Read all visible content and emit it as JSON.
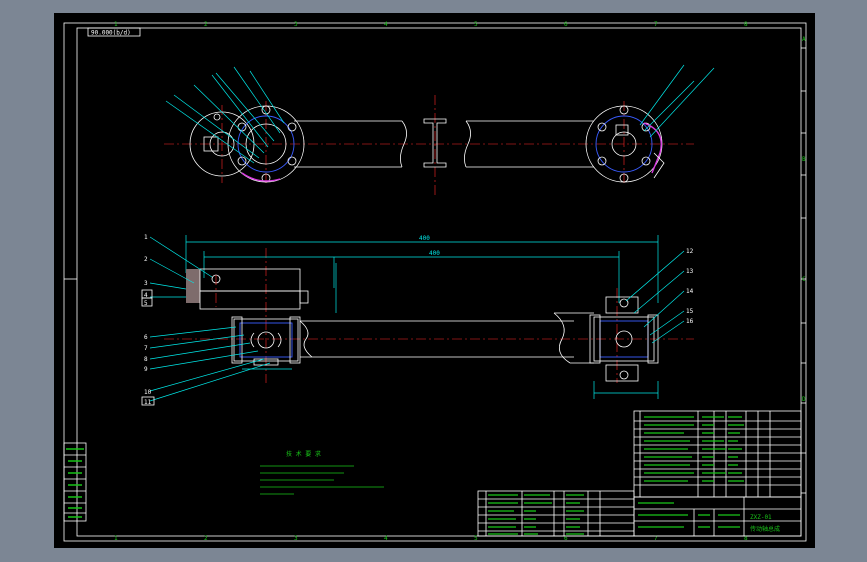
{
  "drawing": {
    "scale_box_label": "90.000(b/d)",
    "border_letters": [
      "1",
      "2",
      "3",
      "4",
      "5",
      "6",
      "7",
      "8"
    ],
    "border_rows": [
      "A",
      "B",
      "C",
      "D"
    ],
    "part_balloons": [
      {
        "num": "1"
      },
      {
        "num": "2"
      },
      {
        "num": "3"
      },
      {
        "num": "4"
      },
      {
        "num": "5"
      },
      {
        "num": "6"
      },
      {
        "num": "7"
      },
      {
        "num": "8"
      },
      {
        "num": "9"
      },
      {
        "num": "10"
      },
      {
        "num": "11"
      },
      {
        "num": "12"
      },
      {
        "num": "13"
      },
      {
        "num": "14"
      },
      {
        "num": "15"
      },
      {
        "num": "16"
      }
    ],
    "dim_overall": "400",
    "dim_inner": "400",
    "tech_title": "技 术 要 求",
    "title_block": {
      "drawing_no": "ZXZ-01",
      "part_name": "传动轴总成"
    }
  },
  "colors": {
    "frame": "#ffffff",
    "annotation": "#00e8e8",
    "text": "#19c519",
    "centerline": "#ff2626",
    "hidden": "#3a5cff",
    "section": "#d83adf"
  }
}
